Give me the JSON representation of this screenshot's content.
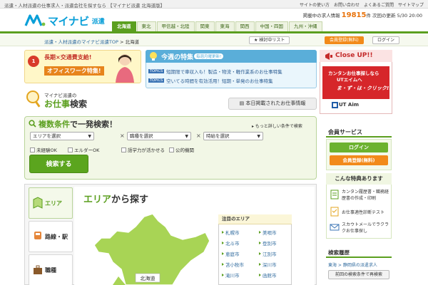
{
  "top": {
    "tagline": "派遣・人材派遣の仕事求人・派遣会社を探すなら 【マイナビ派遣 北海道版】",
    "links": [
      "サイトの使い方",
      "お問い合わせ",
      "よくあるご質問",
      "サイトマップ"
    ]
  },
  "header": {
    "brand": "マイナビ",
    "brand_sub": "派遣",
    "regions": [
      "北海道",
      "東北",
      "甲信越・北陸",
      "関東",
      "東海",
      "関西",
      "中国・四国",
      "九州・沖縄"
    ],
    "active_region": "北海道",
    "jobcount_label": "掲載中の求人情報",
    "jobcount_value": "19815",
    "jobcount_unit": "件",
    "update_text": "次回の更新 5/30 20:00"
  },
  "breadcrumb": {
    "link1": "派遣・人材派遣のマイナビ派遣TOP",
    "sep": " > ",
    "current": "北海道"
  },
  "account": {
    "check_list": "検討中リスト",
    "register": "会員登録(無料)",
    "login": "ログイン"
  },
  "banner1": {
    "badge": "1",
    "line1": "長期×交通費支給!",
    "line2": "オフィスワーク特集!"
  },
  "feature": {
    "title": "今週の特集",
    "badge": "毎週月曜更新!",
    "topics": [
      {
        "tag": "TOPICS",
        "text": "短期限で車収入も！製造・物流・軽作業系のお仕事特集"
      },
      {
        "tag": "TOPICS",
        "text": "空いてる時間を有効活用！短期・単発のお仕事特集"
      }
    ]
  },
  "closeup": {
    "title": "Close UP!!",
    "line1": "カンタンお仕事探しなら",
    "line2": "UTエイムへ",
    "line3": "ま・ず・は・クリック!!",
    "logo": "UT Aim"
  },
  "oshigoto": {
    "sub": "マイナビ派遣の",
    "title_a": "お仕事",
    "title_b": "検索"
  },
  "today_button": "本日掲載されたお仕事情報",
  "search": {
    "title_a": "複数条件",
    "title_b": "で一発検索！",
    "advanced_link": "もっと詳しい条件で検索",
    "area_select": "エリアを選択",
    "job_select": "職種を選択",
    "time_select": "時給を選択",
    "times": "×",
    "checkboxes": [
      "未経験OK",
      "エルダーOK",
      "語学力が活かせる",
      "公的機関"
    ],
    "button": "検索する"
  },
  "member": {
    "title": "会員サービス",
    "login": "ログイン",
    "register": "会員登録(無料)",
    "perks_title": "こんな特典あります",
    "perks": [
      {
        "icon": "document-icon",
        "text": "カンタン履歴書・職務経歴書の作成・印刷"
      },
      {
        "icon": "checklist-icon",
        "text": "お仕事適性診断テスト"
      },
      {
        "icon": "mail-icon",
        "text": "スカウトメールでラクラクお仕事探し"
      }
    ]
  },
  "history": {
    "title": "検索履歴",
    "item": "東海 > 静岡県の派遣求人",
    "button": "前回の検索条件で再検索"
  },
  "tabs": [
    "エリア",
    "路線・駅",
    "職種"
  ],
  "area": {
    "title_a": "エリア",
    "title_b": "から探す",
    "map_label": "北海道",
    "notable_title": "注目のエリア",
    "cities": [
      "札幌市",
      "美唄市",
      "北斗市",
      "登別市",
      "恵庭市",
      "江別市",
      "苫小牧市",
      "深川市",
      "滝川市",
      "函館市"
    ]
  },
  "colors": {
    "brand_blue": "#0a9fd8",
    "green": "#5b9f1f",
    "orange": "#f28a1a",
    "red": "#d6262a"
  }
}
